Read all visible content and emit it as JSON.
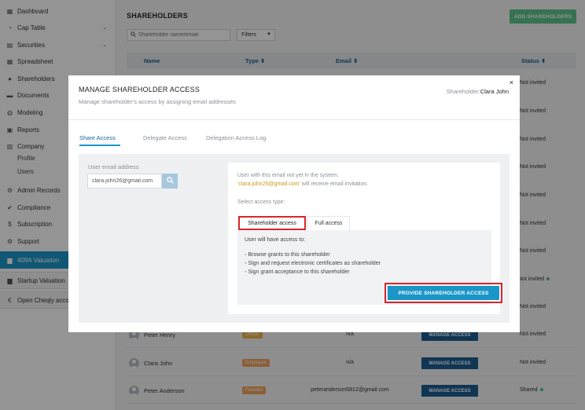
{
  "sidebar": {
    "items": [
      {
        "label": "Dashboard",
        "icon": "dashboard-icon",
        "glyph": "▦"
      },
      {
        "label": "Cap Table",
        "icon": "pie-chart-icon",
        "glyph": "◔",
        "chevron": "⌄"
      },
      {
        "label": "Securities",
        "icon": "document-icon",
        "glyph": "▤",
        "chevron": "⌄"
      },
      {
        "label": "Spreadsheet",
        "icon": "grid-icon",
        "glyph": "▦"
      },
      {
        "label": "Shareholders",
        "icon": "user-icon",
        "glyph": "●"
      },
      {
        "label": "Documents",
        "icon": "folder-icon",
        "glyph": "▬"
      },
      {
        "label": "Modeling",
        "icon": "bulb-icon",
        "glyph": "◍"
      },
      {
        "label": "Reports",
        "icon": "report-icon",
        "glyph": "▣"
      },
      {
        "label": "Company",
        "icon": "building-icon",
        "glyph": "▥"
      },
      {
        "label": "Admin Records",
        "icon": "settings-icon",
        "glyph": "⚙"
      },
      {
        "label": "Compliance",
        "icon": "check-circle-icon",
        "glyph": "✔"
      },
      {
        "label": "Subscription",
        "icon": "dollar-icon",
        "glyph": "$"
      },
      {
        "label": "Support",
        "icon": "gear-icon",
        "glyph": "⚙"
      },
      {
        "label": "409A Valuation",
        "icon": "file-icon",
        "glyph": "▆"
      },
      {
        "label": "Startup Valuation",
        "icon": "file-icon",
        "glyph": "▆"
      },
      {
        "label": "Open Cheqly acco",
        "icon": "cheqly-logo-icon",
        "glyph": "€"
      }
    ],
    "company_sub": [
      "Profile",
      "Users"
    ]
  },
  "main": {
    "title": "SHAREHOLDERS",
    "add_button": "ADD SHAREHOLDERS",
    "search_placeholder": "Shareholder name/email",
    "filters_label": "Filters",
    "columns": {
      "name": "Name",
      "type": "Type",
      "email": "Email",
      "status": "Status",
      "sort_glyph": "⬍"
    },
    "status_column": [
      "Not invited",
      "Not invited",
      "Not invited",
      "Not invited",
      "Not invited",
      "Not invited",
      "Not invited",
      "Not invited",
      "Not invited"
    ],
    "rows": [
      {
        "name": "Peter Henry",
        "type": "Officer",
        "type_color": "#f0b54d",
        "email": "n/a",
        "action": "MANAGE ACCESS",
        "status": "Not invited"
      },
      {
        "name": "Clara John",
        "type": "Employee",
        "type_color": "#f0a45d",
        "email": "n/a",
        "action": "MANAGE ACCESS",
        "status": "Not invited"
      },
      {
        "name": "Peter Anderson",
        "type": "Founder",
        "type_color": "#f0a45d",
        "email": "peteranderson5812@gmail.com",
        "action": "MANAGE ACCESS",
        "status": "Shared"
      }
    ]
  },
  "modal": {
    "title": "MANAGE SHAREHOLDER ACCESS",
    "subtitle": "Manage shareholder's access by assigning email addresses",
    "shareholder_label": "Shareholder:",
    "shareholder_name": "Clara John",
    "close_glyph": "×",
    "tabs": [
      "Share Access",
      "Delegate Access",
      "Delegation Access Log"
    ],
    "email_label": "User email address",
    "email_value": "clara.john26@gmail.com",
    "info_line1": "User with this email not yet in the system.",
    "info_email": "'clara.john26@gmail.com'",
    "info_line2_rest": " will receive email invitation.",
    "select_label": "Select access type:",
    "access_tabs": [
      "Shareholder access",
      "Full access"
    ],
    "access_intro": "User will have access to:",
    "access_items": [
      "Browse grants to this shareholder",
      "Sign and request electronic certificates as shareholder",
      "Sign grant acceptance to this shareholder"
    ],
    "bullet": "◦",
    "provide_button": "PROVIDE SHAREHOLDER ACCESS"
  }
}
